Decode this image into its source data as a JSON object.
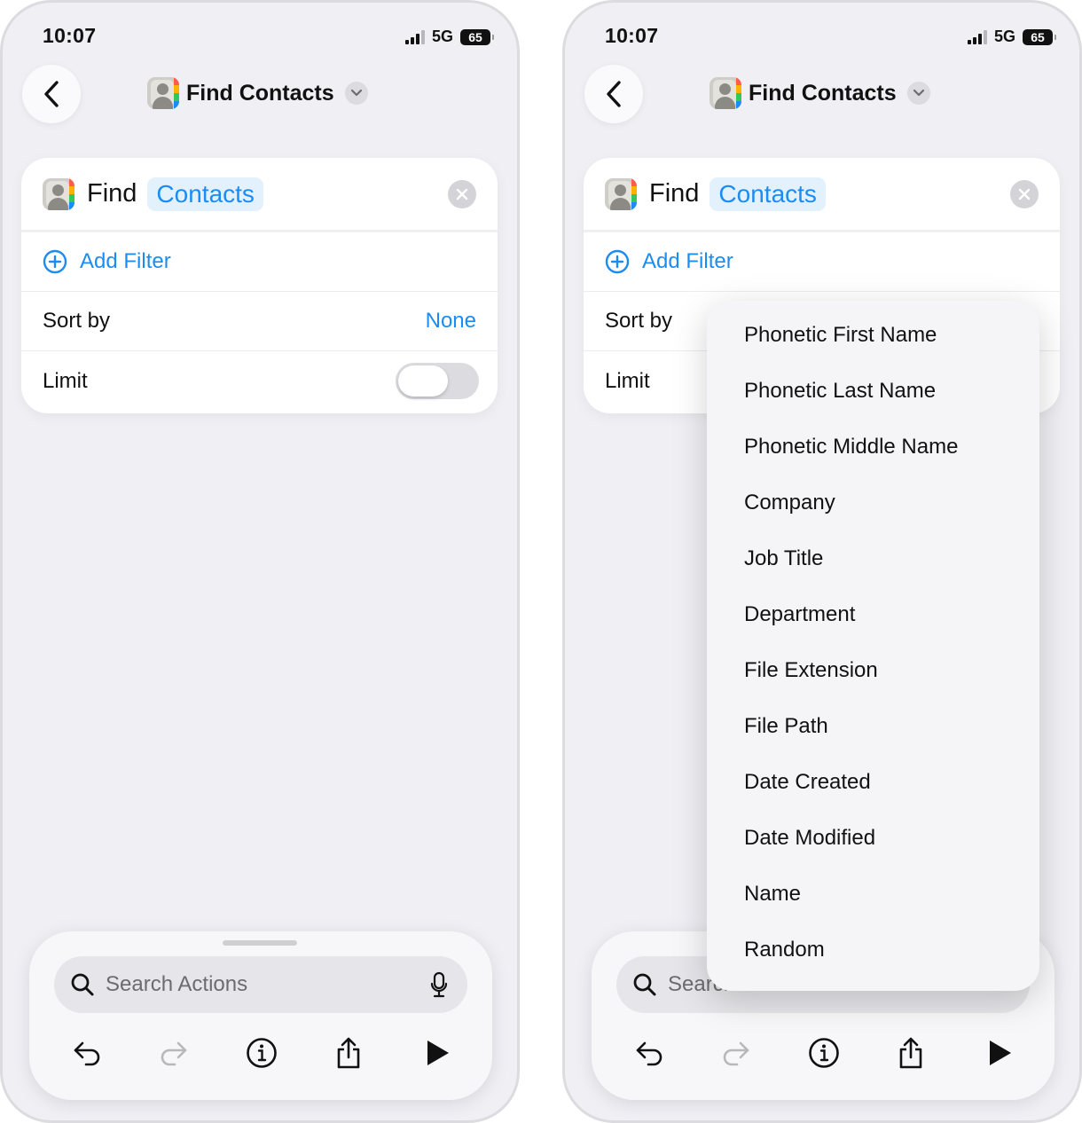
{
  "status": {
    "time": "10:07",
    "network": "5G",
    "battery": "65"
  },
  "nav": {
    "title": "Find Contacts"
  },
  "action": {
    "verb": "Find",
    "token": "Contacts",
    "add_filter_label": "Add Filter",
    "sort_label": "Sort by",
    "sort_value": "None",
    "limit_label": "Limit",
    "limit_enabled": false
  },
  "search": {
    "placeholder": "Search Actions"
  },
  "toolbar_icons": [
    "undo-icon",
    "redo-icon",
    "info-icon",
    "share-icon",
    "play-icon"
  ],
  "sort_menu": {
    "items": [
      "Phonetic First Name",
      "Phonetic Last Name",
      "Phonetic Middle Name",
      "Company",
      "Job Title",
      "Department",
      "File Extension",
      "File Path",
      "Date Created",
      "Date Modified",
      "Name",
      "Random"
    ]
  },
  "colors": {
    "accent": "#1b8cf2",
    "background": "#efeff4",
    "card": "#ffffff",
    "token_bg": "#e3f1fd"
  }
}
